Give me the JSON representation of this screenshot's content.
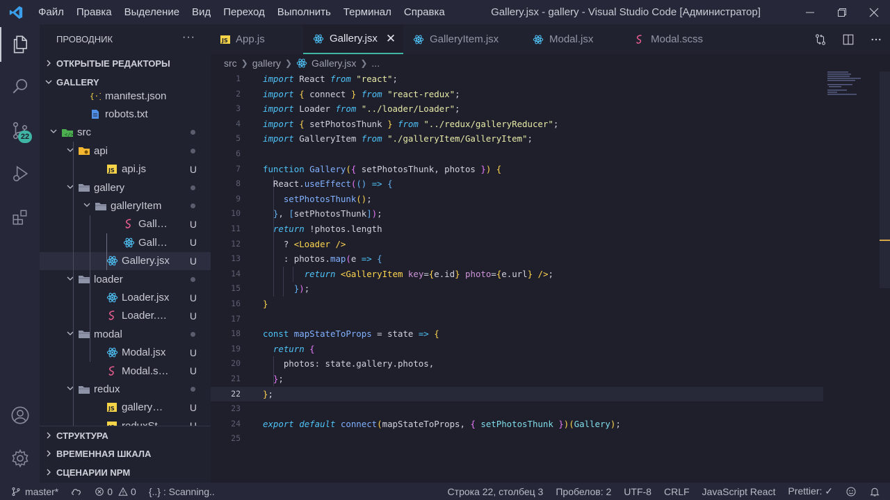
{
  "titlebar": {
    "menu": [
      "Файл",
      "Правка",
      "Выделение",
      "Вид",
      "Переход",
      "Выполнить",
      "Терминал",
      "Справка"
    ],
    "title": "Gallery.jsx - gallery - Visual Studio Code [Администратор]"
  },
  "activitybar": {
    "scm_badge": "22"
  },
  "sidebar": {
    "header": "ПРОВОДНИК",
    "more": "···",
    "open_editors": "ОТКРЫТЫЕ РЕДАКТОРЫ",
    "folder": "GALLERY",
    "tree": [
      {
        "label": "manifest.json",
        "icon": "json-icon",
        "depth": 1,
        "type": "file",
        "status": ""
      },
      {
        "label": "robots.txt",
        "icon": "text-file-icon",
        "depth": 1,
        "type": "file",
        "status": ""
      },
      {
        "label": "src",
        "icon": "folder-src-icon",
        "depth": 0,
        "type": "folder",
        "status": "dot"
      },
      {
        "label": "api",
        "icon": "folder-api-icon",
        "depth": 1,
        "type": "folder",
        "status": "dot"
      },
      {
        "label": "api.js",
        "icon": "js-icon",
        "depth": 2,
        "type": "file",
        "status": "U"
      },
      {
        "label": "gallery",
        "icon": "folder-icon",
        "depth": 1,
        "type": "folder",
        "status": "dot"
      },
      {
        "label": "galleryItem",
        "icon": "folder-icon",
        "depth": 2,
        "type": "folder",
        "status": "dot"
      },
      {
        "label": "GallaryIt...",
        "icon": "scss-icon",
        "depth": 3,
        "type": "file",
        "status": "U"
      },
      {
        "label": "GalleryIt...",
        "icon": "react-icon",
        "depth": 3,
        "type": "file",
        "status": "U"
      },
      {
        "label": "Gallery.jsx",
        "icon": "react-icon",
        "depth": 2,
        "type": "file",
        "status": "U",
        "selected": true
      },
      {
        "label": "loader",
        "icon": "folder-icon",
        "depth": 1,
        "type": "folder",
        "status": "dot"
      },
      {
        "label": "Loader.jsx",
        "icon": "react-icon",
        "depth": 2,
        "type": "file",
        "status": "U"
      },
      {
        "label": "Loader.scss",
        "icon": "scss-icon",
        "depth": 2,
        "type": "file",
        "status": "U"
      },
      {
        "label": "modal",
        "icon": "folder-icon",
        "depth": 1,
        "type": "folder",
        "status": "dot"
      },
      {
        "label": "Modal.jsx",
        "icon": "react-icon",
        "depth": 2,
        "type": "file",
        "status": "U"
      },
      {
        "label": "Modal.scss",
        "icon": "scss-icon",
        "depth": 2,
        "type": "file",
        "status": "U"
      },
      {
        "label": "redux",
        "icon": "folder-icon",
        "depth": 1,
        "type": "folder",
        "status": "dot"
      },
      {
        "label": "galleryRedu...",
        "icon": "js-icon",
        "depth": 2,
        "type": "file",
        "status": "U"
      },
      {
        "label": "reduxStore.js",
        "icon": "js-icon",
        "depth": 2,
        "type": "file",
        "status": "U"
      }
    ],
    "sections": [
      "СТРУКТУРА",
      "ВРЕМЕННАЯ ШКАЛА",
      "СЦЕНАРИИ NPM"
    ]
  },
  "tabs": [
    {
      "label": "App.js",
      "icon": "js-icon",
      "active": false
    },
    {
      "label": "Gallery.jsx",
      "icon": "react-icon",
      "active": true
    },
    {
      "label": "GalleryItem.jsx",
      "icon": "react-icon",
      "active": false
    },
    {
      "label": "Modal.jsx",
      "icon": "react-icon",
      "active": false
    },
    {
      "label": "Modal.scss",
      "icon": "scss-icon",
      "active": false
    }
  ],
  "tab_close": "✕",
  "breadcrumb": [
    "src",
    "gallery",
    "Gallery.jsx",
    "..."
  ],
  "editor": {
    "current_line": 22,
    "lines": [
      "1",
      "2",
      "3",
      "4",
      "5",
      "6",
      "7",
      "8",
      "9",
      "10",
      "11",
      "12",
      "13",
      "14",
      "15",
      "16",
      "17",
      "18",
      "19",
      "20",
      "21",
      "22",
      "23",
      "24",
      "25"
    ]
  },
  "statusbar": {
    "branch": "master*",
    "errors": "0",
    "warnings": "0",
    "scanning": "{..} : Scanning..",
    "position": "Строка 22, столбец 3",
    "spaces": "Пробелов: 2",
    "encoding": "UTF-8",
    "eol": "CRLF",
    "language": "JavaScript React",
    "prettier": "Prettier: ✓"
  },
  "colors": {
    "accent": "#3fb5a6",
    "react": "#4fc3f7",
    "js": "#f5d547",
    "scss": "#e85d8f"
  }
}
